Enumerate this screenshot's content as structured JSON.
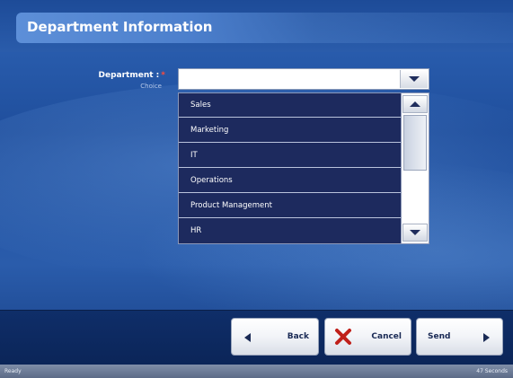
{
  "header": {
    "title": "Department Information"
  },
  "form": {
    "department_label": "Department :",
    "required_mark": "*",
    "department_sublabel": "Choice",
    "department_value": "",
    "options": [
      "Sales",
      "Marketing",
      "IT",
      "Operations",
      "Product Management",
      "HR"
    ]
  },
  "buttons": {
    "back": "Back",
    "cancel": "Cancel",
    "send": "Send"
  },
  "status": {
    "left": "Ready",
    "right": "47 Seconds"
  },
  "icons": {
    "dropdown": "chevron-down-icon",
    "scroll_up": "scroll-up-icon",
    "scroll_down": "scroll-down-icon",
    "back": "arrow-left-icon",
    "cancel": "close-icon",
    "send": "arrow-right-icon"
  },
  "colors": {
    "list_bg": "#1d2a5e",
    "cancel_x": "#c0201a",
    "title_bar": "#4c7fcc"
  }
}
